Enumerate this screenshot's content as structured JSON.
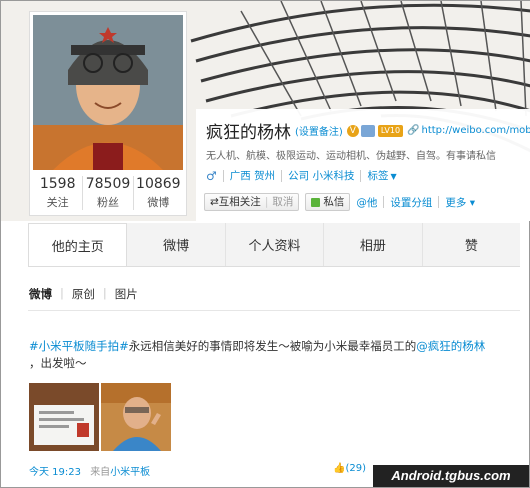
{
  "profile": {
    "name": "疯狂的杨林",
    "remark_label": "(设置备注)",
    "vip_badge": "LV10",
    "url": "http://weibo.com/mobilake",
    "bio": "无人机、航模、极限运动、运动相机、伪越野、自驾。有事请私信",
    "gender_icon": "♂",
    "location": "广西 贺州",
    "company": "公司 小米科技",
    "tag_label": "标签",
    "stats": [
      {
        "num": "1598",
        "label": "关注"
      },
      {
        "num": "78509",
        "label": "粉丝"
      },
      {
        "num": "10869",
        "label": "微博"
      }
    ]
  },
  "actions": {
    "mutual_follow": "⇄互相关注",
    "cancel": "取消",
    "message": "私信",
    "at": "@他",
    "group": "设置分组",
    "more": "更多 ▾"
  },
  "tabs": [
    "他的主页",
    "微博",
    "个人资料",
    "相册",
    "赞"
  ],
  "subtabs": [
    "微博",
    "原创",
    "图片"
  ],
  "post": {
    "topic": "#小米平板随手拍#",
    "text": "永远相信美好的事情即将发生～被喻为小米最幸福员工的",
    "mention": "@疯狂的杨林",
    "text2": "，出发啦～",
    "time": "今天 19:23",
    "source_prefix": "来自",
    "source": "小米平板",
    "likes": "(29)"
  },
  "watermark": "Android.tgbus.com",
  "colors": {
    "link": "#0a8cd2",
    "accent": "#e8a317"
  }
}
